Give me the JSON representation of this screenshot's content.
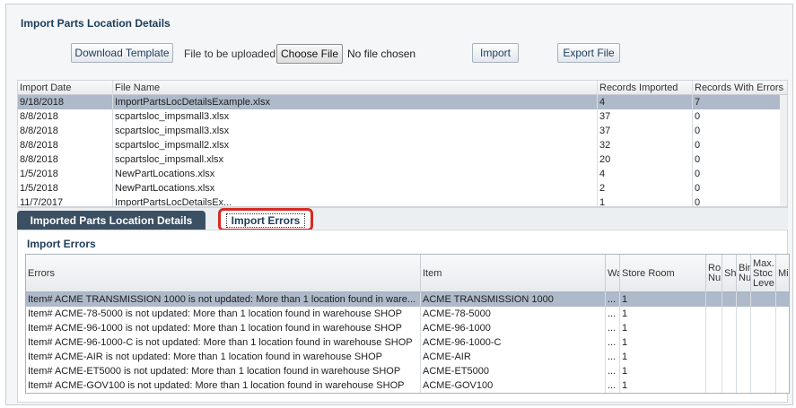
{
  "panel": {
    "title": "Import Parts Location Details"
  },
  "toolbar": {
    "download_template": "Download Template",
    "file_label": "File to be uploaded",
    "choose_file": "Choose File",
    "no_file": "No file chosen",
    "import": "Import",
    "export": "Export File"
  },
  "imports_table": {
    "headers": [
      "Import Date",
      "File Name",
      "Records Imported",
      "Records With Errors"
    ],
    "rows": [
      [
        "9/18/2018",
        "ImportPartsLocDetailsExample.xlsx",
        "4",
        "7"
      ],
      [
        "8/8/2018",
        "scpartsloc_impsmall3.xlsx",
        "37",
        "0"
      ],
      [
        "8/8/2018",
        "scpartsloc_impsmall3.xlsx",
        "37",
        "0"
      ],
      [
        "8/8/2018",
        "scpartsloc_impsmall2.xlsx",
        "32",
        "0"
      ],
      [
        "8/8/2018",
        "scpartsloc_impsmall.xlsx",
        "20",
        "0"
      ],
      [
        "1/5/2018",
        "NewPartLocations.xlsx",
        "4",
        "0"
      ],
      [
        "1/5/2018",
        "NewPartLocations.xlsx",
        "2",
        "0"
      ],
      [
        "11/7/2017",
        "ImportPartsLocDetailsEx...",
        "1",
        "0"
      ]
    ]
  },
  "tabs": {
    "tab1": "Imported Parts Location Details",
    "tab2": "Import Errors"
  },
  "errors_section": {
    "title": "Import Errors",
    "headers": [
      "Errors",
      "Item",
      "Wa",
      "Store Room",
      "Ro Nu",
      "Sh",
      "Bin Nu",
      "Max. Stoc Leve",
      "Mi"
    ],
    "rows": [
      [
        "Item# ACME TRANSMISSION 1000 is not updated: More than 1 location found in ware...",
        "ACME TRANSMISSION 1000",
        "...",
        "1"
      ],
      [
        "Item# ACME-78-5000 is not updated: More than 1 location found in warehouse SHOP",
        "ACME-78-5000",
        "...",
        "1"
      ],
      [
        "Item# ACME-96-1000 is not updated: More than 1 location found in warehouse SHOP",
        "ACME-96-1000",
        "...",
        "1"
      ],
      [
        "Item# ACME-96-1000-C is not updated: More than 1 location found in warehouse SHOP",
        "ACME-96-1000-C",
        "...",
        "1"
      ],
      [
        "Item# ACME-AIR is not updated: More than 1 location found in warehouse SHOP",
        "ACME-AIR",
        "...",
        "1"
      ],
      [
        "Item# ACME-ET5000 is not updated: More than 1 location found in warehouse SHOP",
        "ACME-ET5000",
        "...",
        "1"
      ],
      [
        "Item# ACME-GOV100 is not updated: More than 1 location found in warehouse SHOP",
        "ACME-GOV100",
        "...",
        "1"
      ]
    ]
  }
}
